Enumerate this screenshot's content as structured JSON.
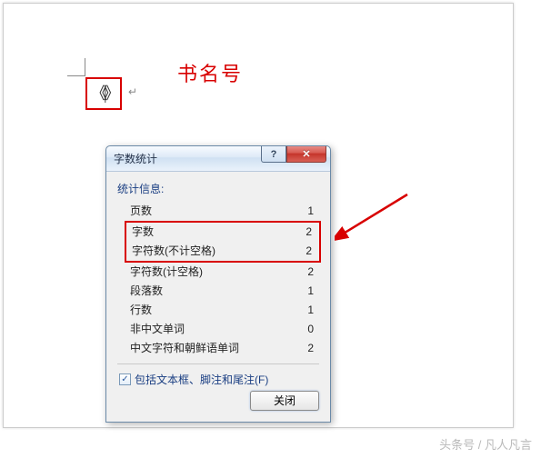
{
  "document": {
    "annotation_label": "书名号",
    "cursor_glyph": "《|》",
    "paragraph_mark": "↵"
  },
  "dialog": {
    "title": "字数统计",
    "help_glyph": "?",
    "close_glyph": "✕",
    "stats_heading": "统计信息:",
    "rows": [
      {
        "label": "页数",
        "value": "1"
      },
      {
        "label": "字数",
        "value": "2"
      },
      {
        "label": "字符数(不计空格)",
        "value": "2"
      },
      {
        "label": "字符数(计空格)",
        "value": "2"
      },
      {
        "label": "段落数",
        "value": "1"
      },
      {
        "label": "行数",
        "value": "1"
      },
      {
        "label": "非中文单词",
        "value": "0"
      },
      {
        "label": "中文字符和朝鲜语单词",
        "value": "2"
      }
    ],
    "checkbox_label": "包括文本框、脚注和尾注(F)",
    "checkbox_checked_glyph": "✓",
    "close_button": "关闭"
  },
  "watermark": "头条号 / 凡人凡言"
}
